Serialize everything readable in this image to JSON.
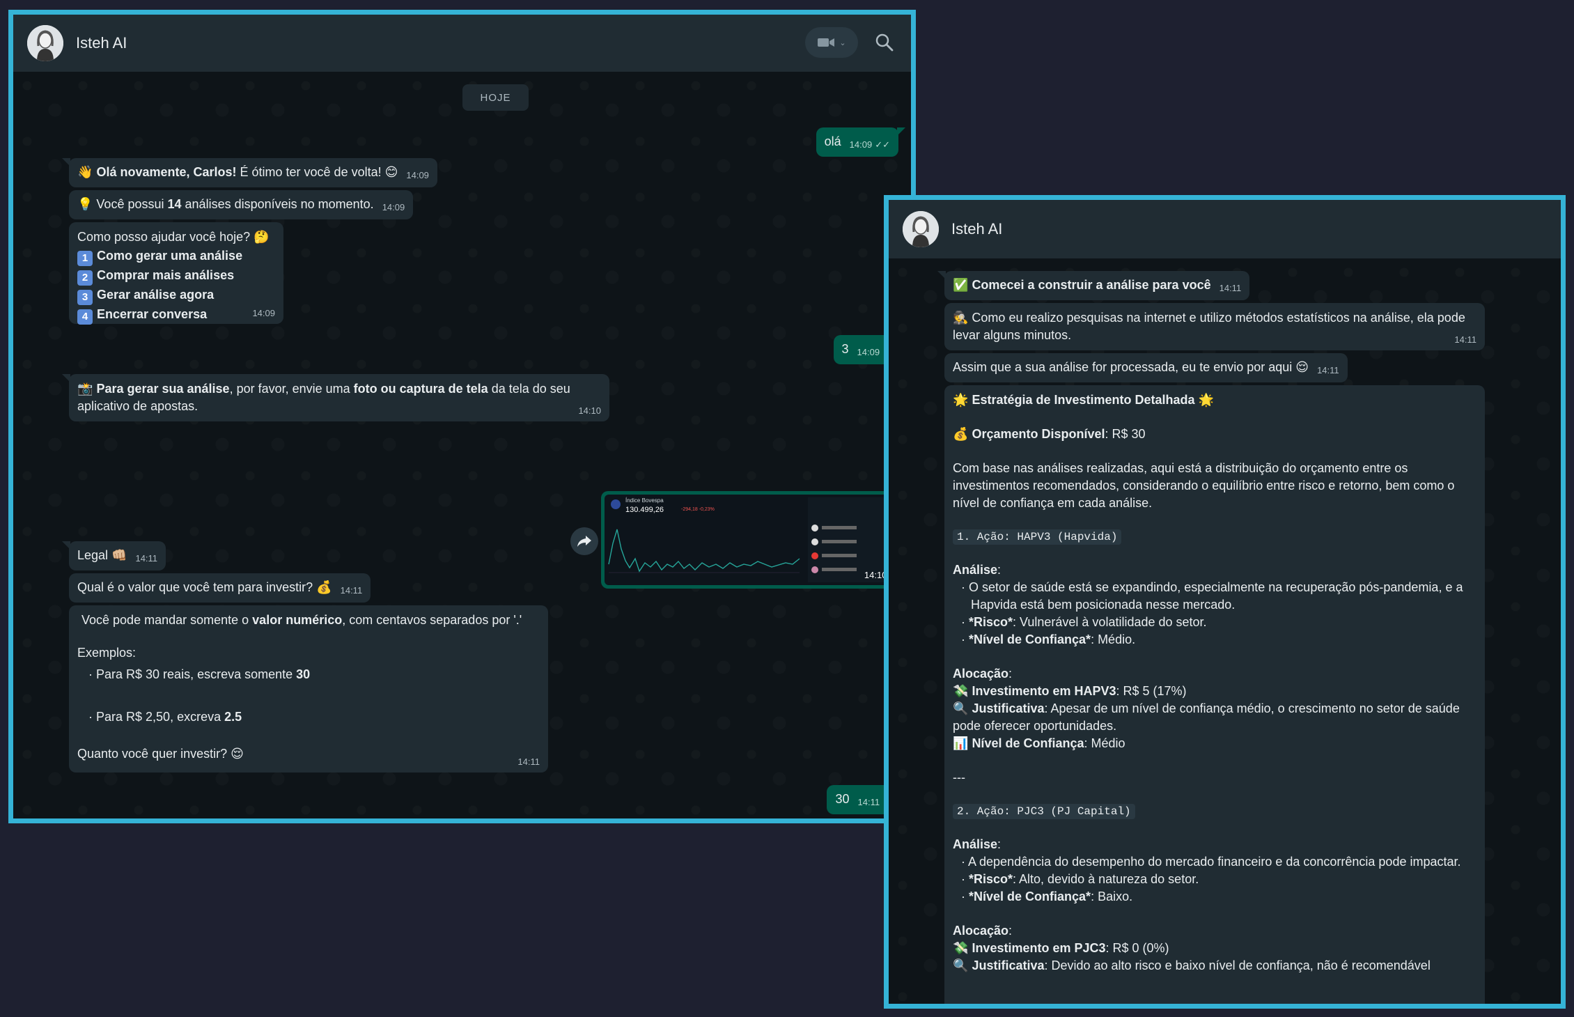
{
  "left_window": {
    "contact_name": "Isteh AI",
    "date_chip": "HOJE",
    "messages": {
      "m1": {
        "text": "olá",
        "time": "14:09"
      },
      "m2": {
        "emoji": "👋",
        "bold": "Olá novamente, Carlos!",
        "rest": " É ótimo ter você de volta! ",
        "emoji2": "😊",
        "time": "14:09"
      },
      "m3": {
        "emoji": "💡",
        "pre": " Você possui ",
        "bold": "14",
        "post": " análises disponíveis no momento.",
        "time": "14:09"
      },
      "m4": {
        "intro": "Como posso ajudar você hoje? ",
        "emoji": "🤔",
        "options": [
          {
            "n": "1",
            "label": "Como gerar uma análise"
          },
          {
            "n": "2",
            "label": "Comprar mais análises"
          },
          {
            "n": "3",
            "label": "Gerar análise agora"
          },
          {
            "n": "4",
            "label": "Encerrar conversa"
          }
        ],
        "time": "14:09"
      },
      "m5": {
        "text": "3",
        "time": "14:09"
      },
      "m6": {
        "emoji": "📸",
        "bold1": "Para gerar sua análise",
        "mid": ", por favor, envie uma ",
        "bold2": "foto ou captura de tela",
        "post": " da tela do seu aplicativo de apostas.",
        "time": "14:10"
      },
      "m7": {
        "time": "14:10",
        "screenshot": {
          "title": "Índice Bovespa",
          "value": "130.499,26",
          "change": "-294,18  -0,23%"
        }
      },
      "m8": {
        "text": "Legal ",
        "emoji": "👊🏼",
        "time": "14:11"
      },
      "m9": {
        "text": "Qual é o valor que você tem para investir? ",
        "emoji": "💰",
        "time": "14:11"
      },
      "m10": {
        "l1_pre": "Você pode mandar somente o ",
        "l1_bold": "valor numérico",
        "l1_post": ", com centavos separados por '.'",
        "examples": "Exemplos:",
        "ex1_pre": "Para R$ 30 reais, escreva somente ",
        "ex1_bold": "30",
        "ex2_pre": "Para R$ 2,50, excreva ",
        "ex2_bold": "2.5",
        "ask": "Quanto você quer investir? ",
        "emoji": "😌",
        "time": "14:11"
      },
      "m11": {
        "text": "30",
        "time": "14:11"
      }
    }
  },
  "right_window": {
    "contact_name": "Isteh AI",
    "r1": {
      "emoji": "✅",
      "bold": "Comecei a construir a análise para você",
      "time": "14:11"
    },
    "r2": {
      "emoji": "🕵️",
      "text": " Como eu realizo pesquisas na internet e utilizo métodos estatísticos na análise, ela pode levar alguns minutos.",
      "time": "14:11"
    },
    "r3": {
      "text": "Assim que a sua análise for processada, eu te envio por aqui ",
      "emoji": "😌",
      "time": "14:11"
    },
    "r4": {
      "title_emoji": "🌟",
      "title": "Estratégia de Investimento Detalhada",
      "budget_emoji": "💰",
      "budget_label": "Orçamento Disponível",
      "budget_value": ": R$ 30",
      "intro": "Com base nas análises realizadas, aqui está a distribuição do orçamento entre os investimentos recomendados, considerando o equilíbrio entre risco e retorno, bem como o nível de confiança em cada análise.",
      "s1_code": "1. Ação: HAPV3 (Hapvida)",
      "analysis_label": "Análise",
      "s1_b1": "O setor de saúde está se expandindo, especialmente na recuperação pós-pandemia, e a Hapvida está bem posicionada nesse mercado.",
      "risk_label": "*Risco*",
      "s1_risk": ": Vulnerável à volatilidade do setor.",
      "conf_label": "*Nível de Confiança*",
      "s1_conf": ": Médio.",
      "alloc_label": "Alocação",
      "money_emoji": "💸",
      "s1_inv_label": "Investimento em HAPV3",
      "s1_inv_value": ": R$ 5 (17%)",
      "just_emoji": "🔍",
      "just_label": "Justificativa",
      "s1_just": ": Apesar de um nível de confiança médio, o crescimento no setor de saúde pode oferecer oportunidades.",
      "chart_emoji": "📊",
      "level_label": "Nível de Confiança",
      "s1_level": ": Médio",
      "sep": "---",
      "s2_code": "2. Ação: PJC3 (PJ Capital)",
      "s2_b1": "A dependência do desempenho do mercado financeiro e da concorrência pode impactar.",
      "s2_risk": ": Alto, devido à natureza do setor.",
      "s2_conf": ": Baixo.",
      "s2_inv_label": "Investimento em PJC3",
      "s2_inv_value": ": R$ 0 (0%)",
      "s2_just": ": Devido ao alto risco e baixo nível de confiança, não é recomendável"
    }
  },
  "colors": {
    "frame": "#35b3d6",
    "incoming": "#202c33",
    "outgoing": "#005c4b",
    "header": "#202c33",
    "backdrop": "#1e2030"
  }
}
